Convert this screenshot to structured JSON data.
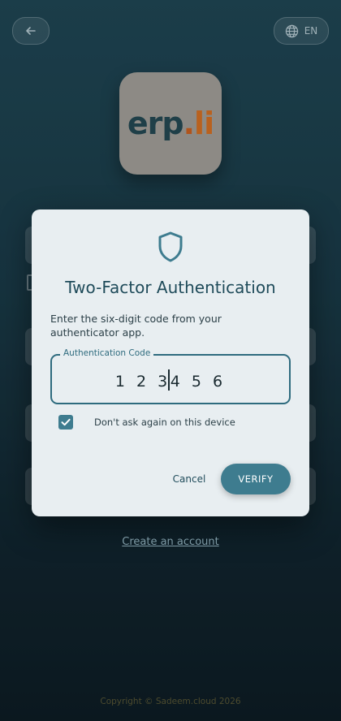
{
  "header": {
    "back_icon": "arrow-left-icon",
    "language": {
      "icon": "globe-icon",
      "code": "EN"
    }
  },
  "logo": {
    "part1": "erp",
    "dot": ".",
    "part2": "li"
  },
  "dialog": {
    "icon": "shield-icon",
    "title": "Two-Factor Authentication",
    "description": "Enter the six-digit code from your authenticator app.",
    "code_label": "Authentication Code",
    "code_before_cursor": "1 2 3",
    "code_after_cursor": "4 5 6",
    "remember_checked": true,
    "remember_label": "Don't ask again on this device",
    "cancel_label": "Cancel",
    "verify_label": "VERIFY"
  },
  "footer": {
    "create_account": "Create an account",
    "copyright": "Copyright © Sadeem.cloud 2026"
  },
  "colors": {
    "accent": "#3e7c8f",
    "dialog_bg": "#e8eef1",
    "title": "#1f4b5a"
  }
}
